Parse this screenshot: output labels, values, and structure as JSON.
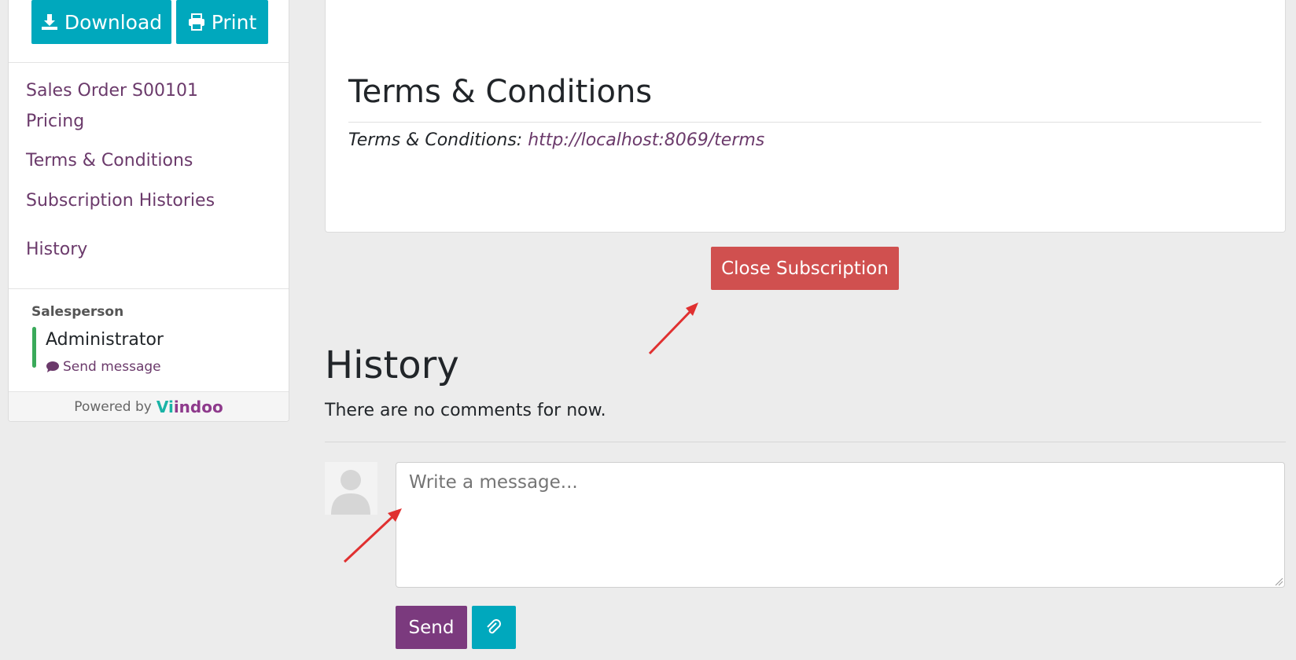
{
  "sidebar": {
    "download_label": "Download",
    "print_label": "Print",
    "nav": [
      "Sales Order S00101",
      "Pricing",
      "Terms & Conditions",
      "Subscription Histories",
      "History"
    ],
    "salesperson_label": "Salesperson",
    "salesperson_name": "Administrator",
    "send_message_label": "Send message",
    "powered_by": "Powered by",
    "brand_part1": "Vi",
    "brand_part2": "indoo"
  },
  "terms": {
    "title": "Terms & Conditions",
    "label": "Terms & Conditions:",
    "link": "http://localhost:8069/terms"
  },
  "actions": {
    "close_subscription": "Close Subscription"
  },
  "history": {
    "title": "History",
    "empty_text": "There are no comments for now.",
    "message_placeholder": "Write a message...",
    "send_label": "Send"
  },
  "colors": {
    "accent_teal": "#00a8bd",
    "danger": "#d0504f",
    "primary_purple": "#7b3a7e",
    "link_purple": "#6b3a6b",
    "annotation_arrow": "#e03030"
  },
  "icons": [
    "download-icon",
    "print-icon",
    "comment-icon",
    "paperclip-icon",
    "avatar-placeholder-icon"
  ]
}
